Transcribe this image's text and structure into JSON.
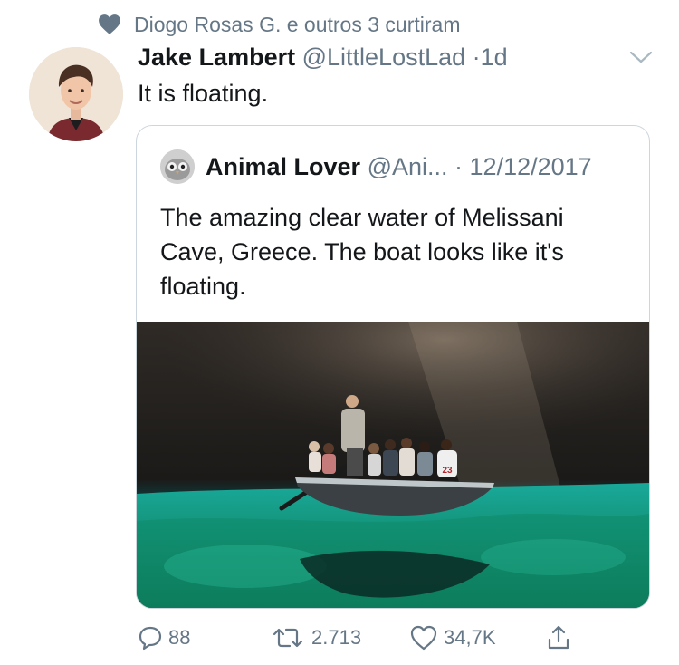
{
  "social_context": {
    "icon": "heart-icon",
    "text": "Diogo Rosas G. e outros 3 curtiram"
  },
  "tweet": {
    "author_name": "Jake Lambert",
    "author_handle": "@LittleLostLad",
    "separator": "·",
    "time": "1d",
    "text": "It is floating."
  },
  "quoted_tweet": {
    "author_name": "Animal Lover",
    "author_handle": "@Ani...",
    "separator": "·",
    "date": "12/12/2017",
    "text": "The amazing clear water of Melissani Cave, Greece. The boat looks like it's floating.",
    "image_number": "23"
  },
  "actions": {
    "reply_count": "88",
    "retweet_count": "2.713",
    "like_count": "34,7K"
  },
  "colors": {
    "text": "#14171a",
    "secondary": "#657786",
    "border": "#ccd6dd",
    "water": "#1fa79a"
  }
}
